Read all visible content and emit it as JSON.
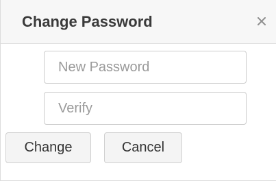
{
  "dialog": {
    "title": "Change Password",
    "close_icon": "close-icon"
  },
  "form": {
    "new_password_placeholder": "New Password",
    "new_password_value": "",
    "verify_placeholder": "Verify",
    "verify_value": ""
  },
  "actions": {
    "change_label": "Change",
    "cancel_label": "Cancel"
  }
}
